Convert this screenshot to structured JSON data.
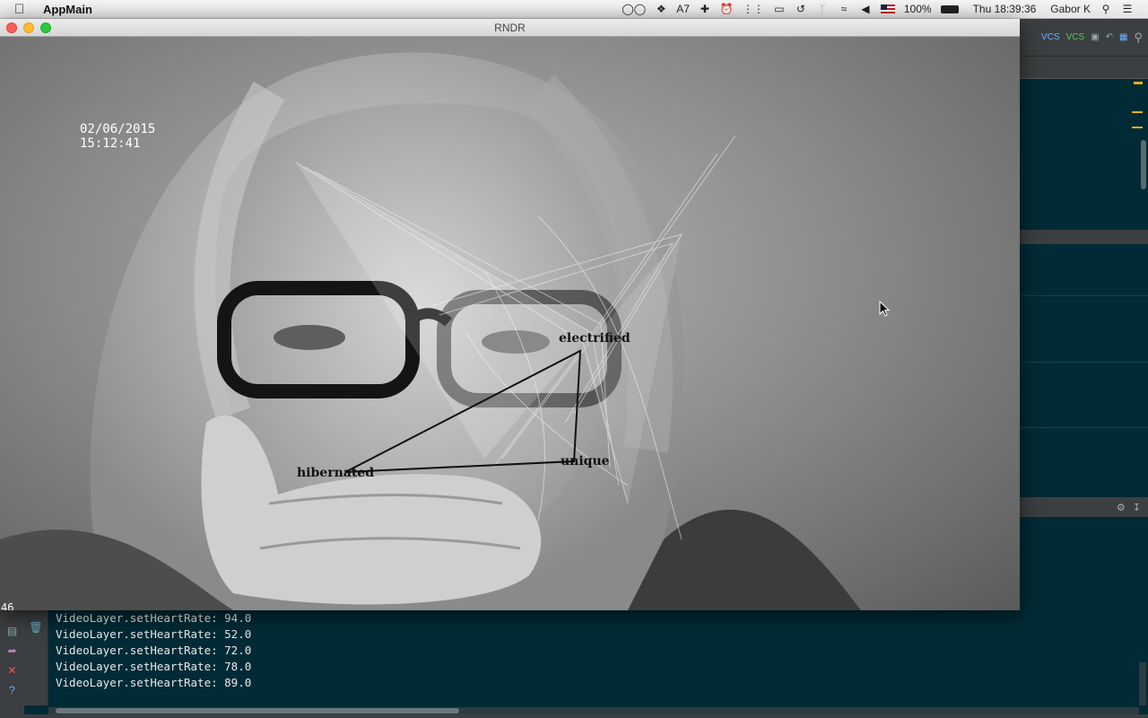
{
  "menubar": {
    "app_name": "AppMain",
    "battery": "100%",
    "clock": "Thu 18:39:36",
    "user": "Gabor K",
    "badge_count": "7"
  },
  "window": {
    "title": "RNDR",
    "date": "02/06/2015",
    "time": "15:12:41",
    "fps": "46",
    "words": {
      "electrified": "electrified",
      "unique": "unique",
      "hibernated": "hibernated"
    }
  },
  "ide": {
    "vcs_label_1": "VCS",
    "vcs_label_2": "VCS"
  },
  "console": {
    "lines": [
      "VideoLayer.setHeartRate: 94.0",
      "VideoLayer.setHeartRate: 52.0",
      "VideoLayer.setHeartRate: 72.0",
      "VideoLayer.setHeartRate: 78.0",
      "VideoLayer.setHeartRate: 89.0"
    ]
  },
  "colors": {
    "menubar": "#e8e8e8",
    "ide_bg": "#002b36",
    "marker": "#e0b020"
  }
}
